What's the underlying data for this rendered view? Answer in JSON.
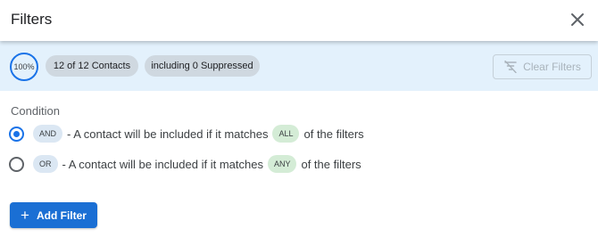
{
  "dialog": {
    "title": "Filters",
    "close_icon": "close-icon"
  },
  "summary": {
    "progress_percent": 100,
    "progress_label": "100%",
    "contacts_chip": "12 of 12 Contacts",
    "suppressed_chip": "including 0 Suppressed",
    "clear_filters_label": "Clear Filters",
    "clear_filters_icon": "filter-off-icon",
    "clear_filters_disabled": true
  },
  "condition": {
    "label": "Condition",
    "options": [
      {
        "operator": "AND",
        "text_before": "- A contact will be included if it matches",
        "match": "ALL",
        "text_after": "of the filters",
        "selected": true
      },
      {
        "operator": "OR",
        "text_before": "- A contact will be included if it matches",
        "match": "ANY",
        "text_after": "of the filters",
        "selected": false
      }
    ]
  },
  "actions": {
    "add_filter_label": "Add Filter",
    "add_filter_icon": "plus-icon"
  },
  "colors": {
    "accent": "#1a73e8",
    "summary_bg": "#e3f1fc",
    "match_pill_bg": "#d4ecd6",
    "operator_pill_bg": "#dbe7f3"
  }
}
